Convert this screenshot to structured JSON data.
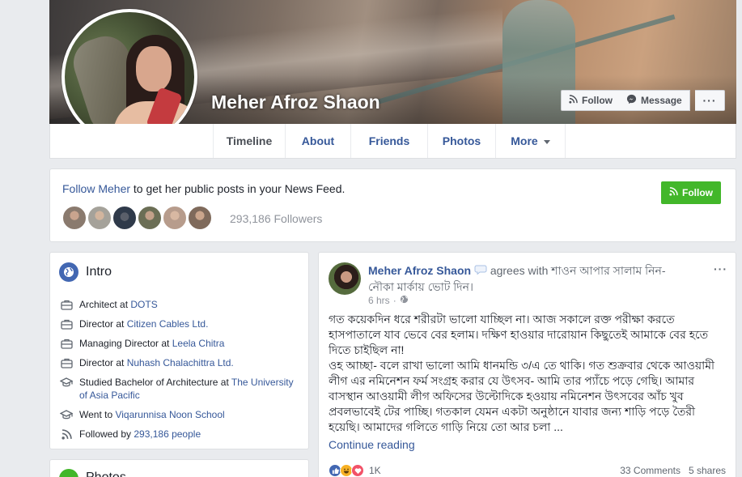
{
  "profile": {
    "name": "Meher Afroz Shaon",
    "buttons": {
      "follow": "Follow",
      "message": "Message",
      "more": "···"
    }
  },
  "nav": {
    "tabs": [
      {
        "label": "Timeline"
      },
      {
        "label": "About"
      },
      {
        "label": "Friends"
      },
      {
        "label": "Photos"
      },
      {
        "label": "More"
      }
    ]
  },
  "follow_card": {
    "prompt_link": "Follow Meher",
    "prompt_rest": " to get her public posts in your News Feed.",
    "button": "Follow",
    "followers": "293,186 Followers",
    "avatar_colors": [
      "#8a7a6e",
      "#a5a29a",
      "#2f3a4a",
      "#6b6e55",
      "#b79c8c",
      "#7f6a5b"
    ]
  },
  "intro": {
    "title": "Intro",
    "items": [
      {
        "icon": "briefcase-icon",
        "prefix": "Architect at ",
        "link": "DOTS"
      },
      {
        "icon": "briefcase-icon",
        "prefix": "Director at ",
        "link": "Citizen Cables Ltd."
      },
      {
        "icon": "briefcase-icon",
        "prefix": "Managing Director at ",
        "link": "Leela Chitra"
      },
      {
        "icon": "briefcase-icon",
        "prefix": "Director at ",
        "link": "Nuhash Chalachittra Ltd."
      },
      {
        "icon": "graduation-cap-icon",
        "prefix": "Studied Bachelor of Architecture at ",
        "link": "The University of Asia Pacific"
      },
      {
        "icon": "graduation-cap-icon",
        "prefix": "Went to ",
        "link": "Viqarunnisa Noon School"
      },
      {
        "icon": "rss-icon",
        "prefix": "Followed by ",
        "link": "293,186 people"
      }
    ]
  },
  "photos_card": {
    "title": "Photos"
  },
  "post": {
    "author": "Meher Afroz Shaon",
    "feeling": " agrees with শাওন আপার সালাম নিন- নৌকা মার্কায় ভোট দিন।",
    "time": "6 hrs",
    "menu": "···",
    "paragraphs": [
      "গত কয়েকদিন ধরে শরীরটা ভালো যাচ্ছিল না। আজ সকালে রক্ত পরীক্ষা করতে হাসপাতালে যাব ভেবে বের হলাম। দক্ষিণ হাওয়ার দারোয়ান কিছুতেই আমাকে বের হতে দিতে চাইছিল না!",
      "ওহ আচ্ছা- বলে রাখা ভালো আমি ধানমন্ডি ৩/এ তে থাকি। গত শুক্রবার থেকে আওয়ামী লীগ এর নমিনেশন ফর্ম সংগ্রহ করার যে উৎসব- আমি তার প্যাঁচে পড়ে গেছি। আমার বাসস্থান আওয়ামী লীগ অফিসের উল্টোদিকে হওয়ায় নমিনেশন উৎসবের আঁচ খুব প্রবলভাবেই টের পাচ্ছি। গতকাল যেমন একটা অনুষ্ঠানে যাবার জন্য শাড়ি পড়ে তৈরী হয়েছি। আমাদের গলিতে গাড়ি নিয়ে তো আর চলা ..."
    ],
    "continue": "Continue reading",
    "reaction_count": "1K",
    "comments": "33 Comments",
    "shares": "5 shares"
  },
  "colors": {
    "brand": "#4267b2",
    "link": "#365899",
    "follow_green": "#42b72a",
    "bg": "#e9ebee"
  }
}
